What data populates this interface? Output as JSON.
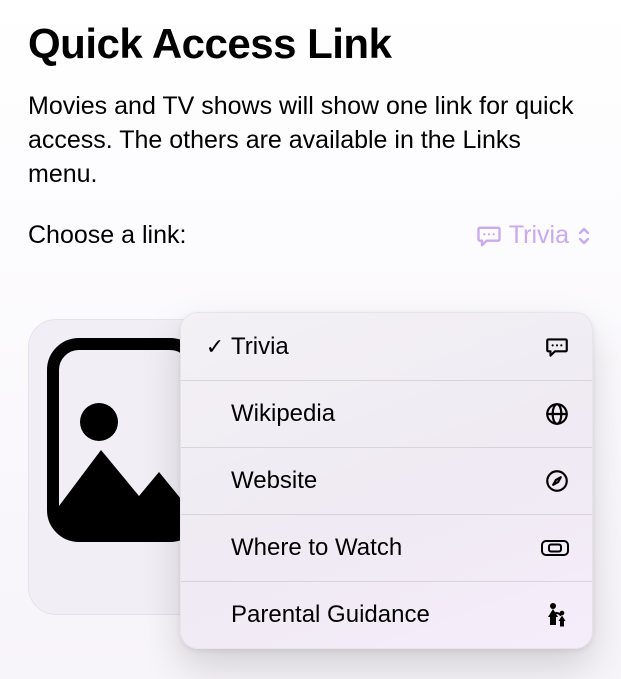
{
  "title": "Quick Access Link",
  "description": "Movies and TV shows will show one link for quick access. The others are available in the Links menu.",
  "choose_label": "Choose a link:",
  "accent_color": "#c9a9f0",
  "select": {
    "value": "Trivia"
  },
  "dropdown": {
    "items": [
      {
        "label": "Trivia",
        "icon": "chat-bubble-icon",
        "selected": true
      },
      {
        "label": "Wikipedia",
        "icon": "globe-icon",
        "selected": false
      },
      {
        "label": "Website",
        "icon": "compass-icon",
        "selected": false
      },
      {
        "label": "Where to Watch",
        "icon": "ticket-icon",
        "selected": false
      },
      {
        "label": "Parental Guidance",
        "icon": "family-icon",
        "selected": false
      }
    ]
  }
}
